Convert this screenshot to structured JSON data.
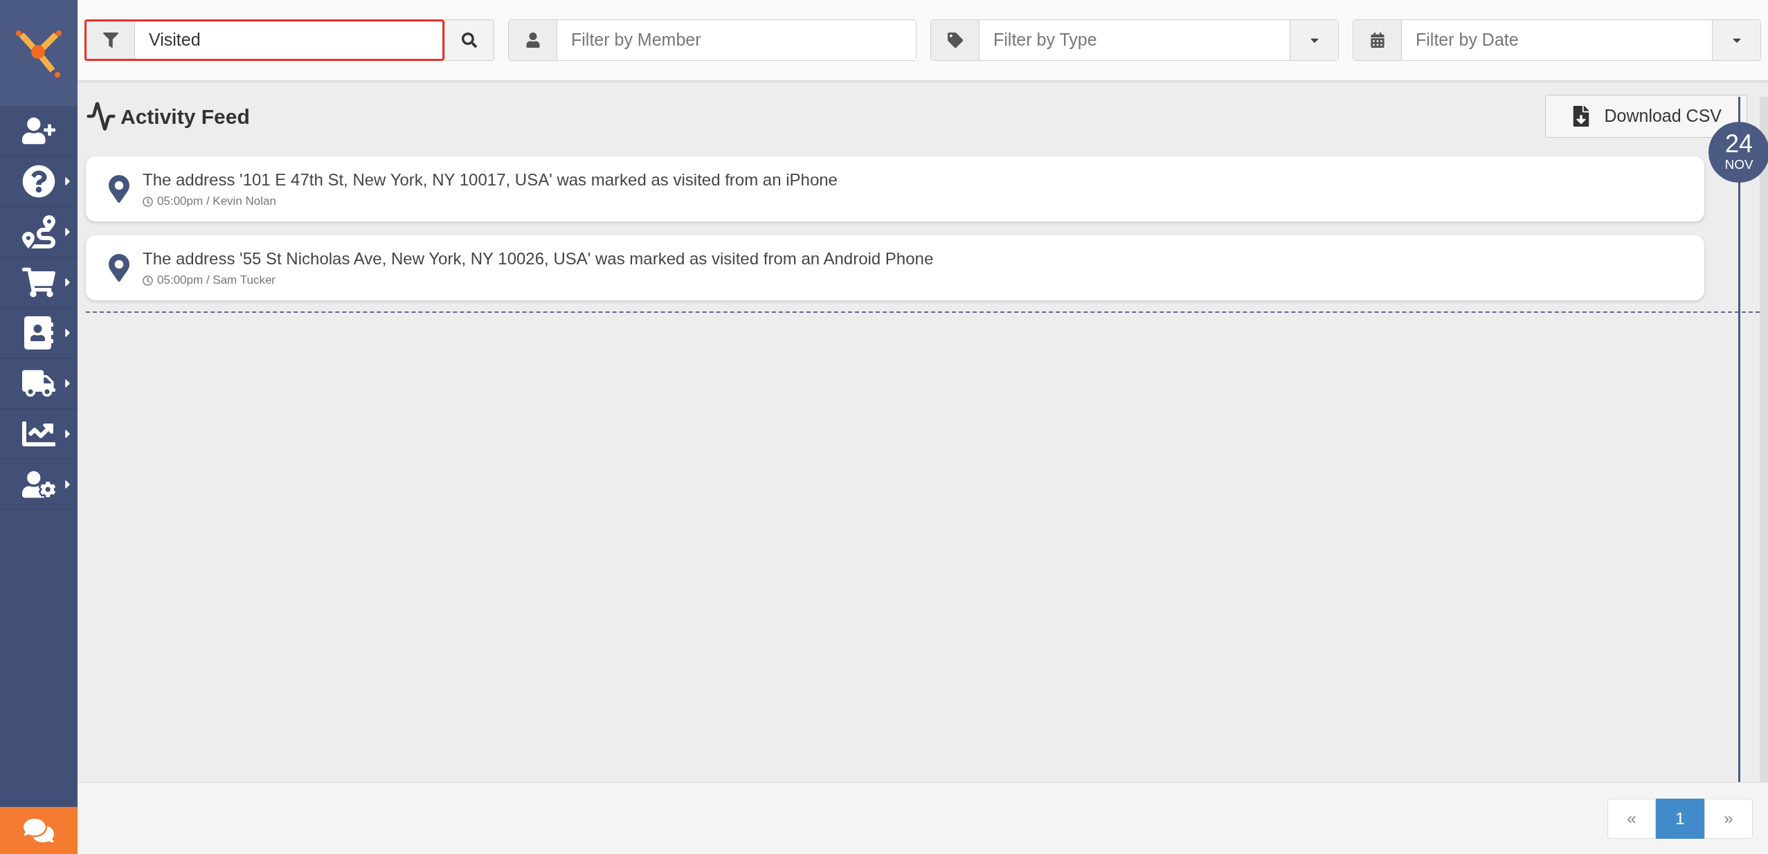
{
  "sidebar": {
    "items": [
      {
        "kind": "link"
      },
      {
        "kind": "submenu"
      },
      {
        "kind": "submenu"
      },
      {
        "kind": "submenu"
      },
      {
        "kind": "submenu"
      },
      {
        "kind": "submenu"
      },
      {
        "kind": "submenu"
      },
      {
        "kind": "submenu"
      }
    ]
  },
  "filters": {
    "search": {
      "value": "Visited",
      "highlighted": true
    },
    "member": {
      "placeholder": "Filter by Member"
    },
    "type": {
      "placeholder": "Filter by Type"
    },
    "date": {
      "placeholder": "Filter by Date"
    }
  },
  "feed": {
    "title": "Activity Feed",
    "download_button": "Download CSV",
    "date": {
      "day": "24",
      "month": "NOV"
    },
    "items": [
      {
        "text": "The address '101 E 47th St, New York, NY 10017, USA' was marked as visited from an iPhone",
        "time": "05:00pm / Kevin Nolan"
      },
      {
        "text": "The address '55 St Nicholas Ave, New York, NY 10026, USA' was marked as visited from an Android Phone",
        "time": "05:00pm / Sam Tucker"
      }
    ]
  },
  "pagination": [
    {
      "label": "«",
      "selected": false
    },
    {
      "label": "1",
      "selected": true
    },
    {
      "label": "»",
      "selected": false
    }
  ]
}
